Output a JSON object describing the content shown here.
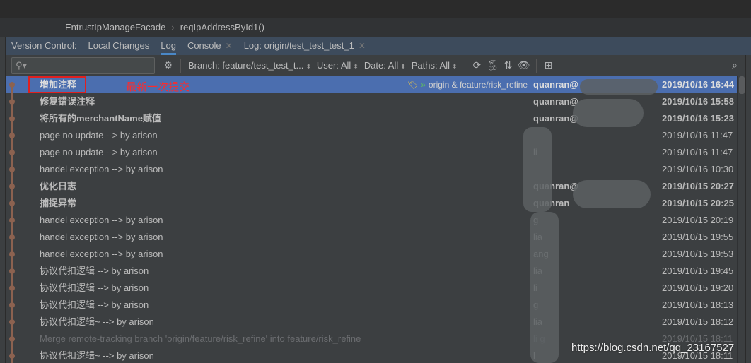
{
  "breadcrumb": {
    "items": [
      "EntrustIpManageFacade",
      "reqIpAddressById1()"
    ]
  },
  "tabs": {
    "label": "Version Control:",
    "items": [
      {
        "label": "Local Changes",
        "active": false,
        "closable": false
      },
      {
        "label": "Log",
        "active": true,
        "closable": false
      },
      {
        "label": "Console",
        "active": false,
        "closable": true
      },
      {
        "label": "Log: origin/test_test_test_1",
        "active": false,
        "closable": true
      }
    ]
  },
  "toolbar": {
    "search": {
      "value": "",
      "placeholder": ""
    },
    "filters": {
      "branch": "Branch: feature/test_test_t...",
      "user": "User: All",
      "date": "Date: All",
      "paths": "Paths: All"
    },
    "icons": [
      "gear-icon",
      "refresh-icon",
      "cherry-pick-icon",
      "sort-icon",
      "eye-icon",
      "new-tab-icon",
      "search-icon"
    ]
  },
  "annotation": "最新一次提交",
  "commits": [
    {
      "message": "增加注释",
      "refs": "origin & feature/risk_refine",
      "author": "quanran@",
      "date": "2019/10/16 16:44",
      "bold": true,
      "selected": true
    },
    {
      "message": "修复错误注释",
      "author": "quanran@",
      "date": "2019/10/16 15:58",
      "bold": true
    },
    {
      "message": "将所有的merchantName赋值",
      "author": "quanran@",
      "date": "2019/10/16 15:23",
      "bold": true
    },
    {
      "message": "page no update --> by arison",
      "author": "",
      "date": "2019/10/16 11:47"
    },
    {
      "message": "page no update --> by arison",
      "author": "li",
      "date": "2019/10/16 11:47"
    },
    {
      "message": "handel exception --> by arison",
      "author": "",
      "date": "2019/10/16 10:30"
    },
    {
      "message": "优化日志",
      "author": "quanran@",
      "date": "2019/10/15 20:27",
      "bold": true
    },
    {
      "message": "捕捉异常",
      "author": "quanran",
      "date": "2019/10/15 20:25",
      "bold": true
    },
    {
      "message": "handel exception --> by arison",
      "author": "g",
      "date": "2019/10/15 20:19"
    },
    {
      "message": "handel exception --> by arison",
      "author": "lia",
      "date": "2019/10/15 19:55"
    },
    {
      "message": "handel exception --> by arison",
      "author": "ang",
      "date": "2019/10/15 19:53"
    },
    {
      "message": "协议代扣逻辑 --> by arison",
      "author": "lia",
      "date": "2019/10/15 19:45"
    },
    {
      "message": "协议代扣逻辑 --> by arison",
      "author": "li",
      "date": "2019/10/15 19:20"
    },
    {
      "message": "协议代扣逻辑 --> by arison",
      "author": "g",
      "date": "2019/10/15 18:13"
    },
    {
      "message": "协议代扣逻辑~ --> by arison",
      "author": "lia",
      "date": "2019/10/15 18:12"
    },
    {
      "message": "Merge remote-tracking branch 'origin/feature/risk_refine' into feature/risk_refine",
      "author": "li g",
      "date": "2019/10/15 18:11",
      "dim": true
    },
    {
      "message": "协议代扣逻辑~ --> by arison",
      "author": "l",
      "date": "2019/10/15 18:11"
    }
  ],
  "colors": {
    "selection": "#4b6eaf",
    "graph": "#8c6250",
    "annotation": "#e02020",
    "tabbar": "#3d4b5c"
  },
  "watermark": "https://blog.csdn.net/qq_23167527"
}
